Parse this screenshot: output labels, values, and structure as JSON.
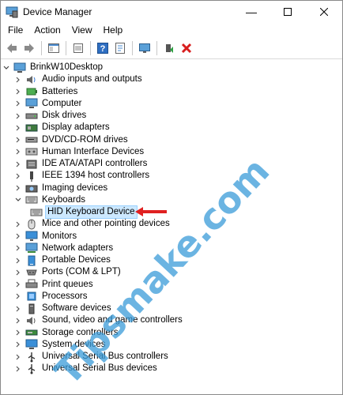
{
  "window": {
    "title": "Device Manager"
  },
  "menu": [
    "File",
    "Action",
    "View",
    "Help"
  ],
  "toolbar": [
    "back-icon",
    "forward-icon",
    "properties-pane-icon",
    "show-hide-icon",
    "help-icon",
    "update-driver-icon",
    "monitor-icon",
    "enable-device-icon",
    "uninstall-icon"
  ],
  "tree": {
    "root": "BrinkW10Desktop",
    "items": [
      {
        "label": "Audio inputs and outputs",
        "icon": "speaker-icon"
      },
      {
        "label": "Batteries",
        "icon": "battery-icon"
      },
      {
        "label": "Computer",
        "icon": "computer-icon"
      },
      {
        "label": "Disk drives",
        "icon": "disk-icon"
      },
      {
        "label": "Display adapters",
        "icon": "display-adapter-icon"
      },
      {
        "label": "DVD/CD-ROM drives",
        "icon": "dvd-icon"
      },
      {
        "label": "Human Interface Devices",
        "icon": "hid-icon"
      },
      {
        "label": "IDE ATA/ATAPI controllers",
        "icon": "ide-icon"
      },
      {
        "label": "IEEE 1394 host controllers",
        "icon": "firewire-icon"
      },
      {
        "label": "Imaging devices",
        "icon": "camera-icon"
      },
      {
        "label": "Keyboards",
        "icon": "keyboard-icon",
        "expanded": true
      },
      {
        "label": "Mice and other pointing devices",
        "icon": "mouse-icon"
      },
      {
        "label": "Monitors",
        "icon": "monitor-icon"
      },
      {
        "label": "Network adapters",
        "icon": "network-icon"
      },
      {
        "label": "Portable Devices",
        "icon": "portable-icon"
      },
      {
        "label": "Ports (COM & LPT)",
        "icon": "port-icon"
      },
      {
        "label": "Print queues",
        "icon": "printer-icon"
      },
      {
        "label": "Processors",
        "icon": "processor-icon"
      },
      {
        "label": "Software devices",
        "icon": "software-icon"
      },
      {
        "label": "Sound, video and game controllers",
        "icon": "sound-icon"
      },
      {
        "label": "Storage controllers",
        "icon": "storage-icon"
      },
      {
        "label": "System devices",
        "icon": "system-icon"
      },
      {
        "label": "Universal Serial Bus controllers",
        "icon": "usb-icon"
      },
      {
        "label": "Universal Serial Bus devices",
        "icon": "usb-device-icon"
      }
    ],
    "child": {
      "parent": "Keyboards",
      "label": "HID Keyboard Device",
      "icon": "keyboard-icon"
    }
  },
  "watermark": {
    "text": "Tipsmake.com",
    "color": "#3a9bd8",
    "accent": "#e0323a"
  },
  "colors": {
    "selection": "#cce8ff",
    "arrow": "#e02020"
  }
}
